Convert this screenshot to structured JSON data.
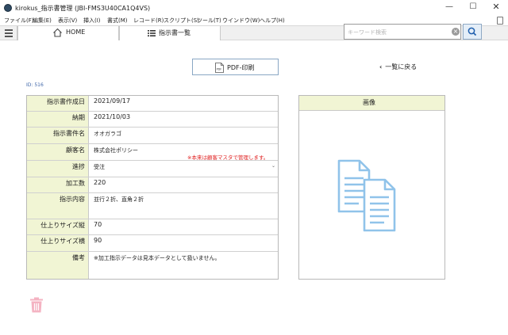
{
  "window": {
    "title": "kirokus_指示書管理 (JBI-FMS3U40CA1Q4VS)",
    "minimize": "—",
    "maximize": "☐",
    "close": "✕"
  },
  "menu": [
    "ファイル(F)",
    "編集(E)",
    "表示(V)",
    "挿入(I)",
    "書式(M)",
    "レコード(R)",
    "スクリプト(S)",
    "ツール(T)",
    "ウインドウ(W)",
    "ヘルプ(H)"
  ],
  "toolbar": {
    "home_label": "HOME",
    "list_label": "指示書一覧",
    "search_placeholder": "キーワード検索",
    "search_value": ""
  },
  "actions": {
    "pdf_label": "PDF-印刷",
    "back_label": "一覧に戻る"
  },
  "record": {
    "id_label": "ID: 516",
    "fields": [
      {
        "label": "指示書作成日",
        "value": "2021/09/17"
      },
      {
        "label": "納期",
        "value": "2021/10/03"
      },
      {
        "label": "指示書件名",
        "value": "オオガラゴ"
      },
      {
        "label": "顧客名",
        "value": "株式会社ポリシー",
        "note": "※本来は顧客マスタで管理します。"
      },
      {
        "label": "進捗",
        "value": "受注",
        "dropdown": "⌄"
      },
      {
        "label": "加工数",
        "value": "220"
      },
      {
        "label": "指示内容",
        "value": "並行２折、直角２折"
      },
      {
        "label": "仕上りサイズ縦",
        "value": "70"
      },
      {
        "label": "仕上りサイズ横",
        "value": "90"
      },
      {
        "label": "備考",
        "value": "※加工指示データは見本データとして扱いません。"
      }
    ]
  },
  "image_panel": {
    "title": "画像"
  },
  "colors": {
    "label_bg": "#f1f5d4",
    "accent_blue": "#2f6fd6",
    "doc_icon": "#90c3ea",
    "trash": "#f4b3c2",
    "note_red": "#e02020"
  },
  "icons": {
    "home": "home-icon",
    "list": "list-icon",
    "search": "search-icon",
    "pdf": "pdf-file-icon",
    "back": "chevron-left-icon",
    "document": "documents-icon",
    "trash": "trash-icon"
  }
}
